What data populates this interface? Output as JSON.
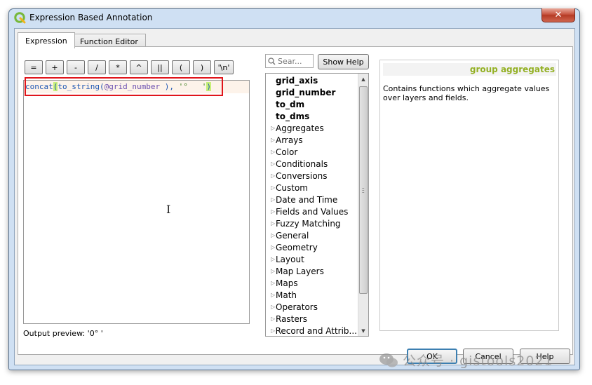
{
  "window": {
    "title": "Expression Based Annotation",
    "close_glyph": "✕"
  },
  "tabs": [
    {
      "label": "Expression",
      "active": true
    },
    {
      "label": "Function Editor",
      "active": false
    }
  ],
  "operators": [
    "=",
    "+",
    "-",
    "/",
    "*",
    "^",
    "||",
    "(",
    ")",
    "'\\n'"
  ],
  "editor": {
    "code_fn": "concat",
    "code_open": "(",
    "code_inner": "to_string(",
    "code_var": "@grid_number",
    "code_mid": " ), ",
    "code_str": "'°   '",
    "code_close": ")"
  },
  "output_preview": "Output preview:  '0°  '",
  "search": {
    "placeholder": "Sear..."
  },
  "show_help_label": "Show Help",
  "functions": [
    {
      "label": "grid_axis",
      "expandable": false
    },
    {
      "label": "grid_number",
      "expandable": false
    },
    {
      "label": "to_dm",
      "expandable": false
    },
    {
      "label": "to_dms",
      "expandable": false
    },
    {
      "label": "Aggregates",
      "expandable": true
    },
    {
      "label": "Arrays",
      "expandable": true
    },
    {
      "label": "Color",
      "expandable": true
    },
    {
      "label": "Conditionals",
      "expandable": true
    },
    {
      "label": "Conversions",
      "expandable": true
    },
    {
      "label": "Custom",
      "expandable": true
    },
    {
      "label": "Date and Time",
      "expandable": true
    },
    {
      "label": "Fields and Values",
      "expandable": true
    },
    {
      "label": "Fuzzy Matching",
      "expandable": true
    },
    {
      "label": "General",
      "expandable": true
    },
    {
      "label": "Geometry",
      "expandable": true
    },
    {
      "label": "Layout",
      "expandable": true
    },
    {
      "label": "Map Layers",
      "expandable": true
    },
    {
      "label": "Maps",
      "expandable": true
    },
    {
      "label": "Math",
      "expandable": true
    },
    {
      "label": "Operators",
      "expandable": true
    },
    {
      "label": "Rasters",
      "expandable": true
    },
    {
      "label": "Record and Attrib...",
      "expandable": true
    }
  ],
  "help": {
    "heading": "group aggregates",
    "text": "Contains functions which aggregate values over layers and fields."
  },
  "buttons": {
    "ok": "OK",
    "cancel": "Cancel",
    "help": "Help"
  },
  "watermark": "公众号 · gistools2021",
  "colors": {
    "accent_green": "#93b023",
    "highlight_red": "#e0151b",
    "code_blue": "#1f57b3"
  }
}
